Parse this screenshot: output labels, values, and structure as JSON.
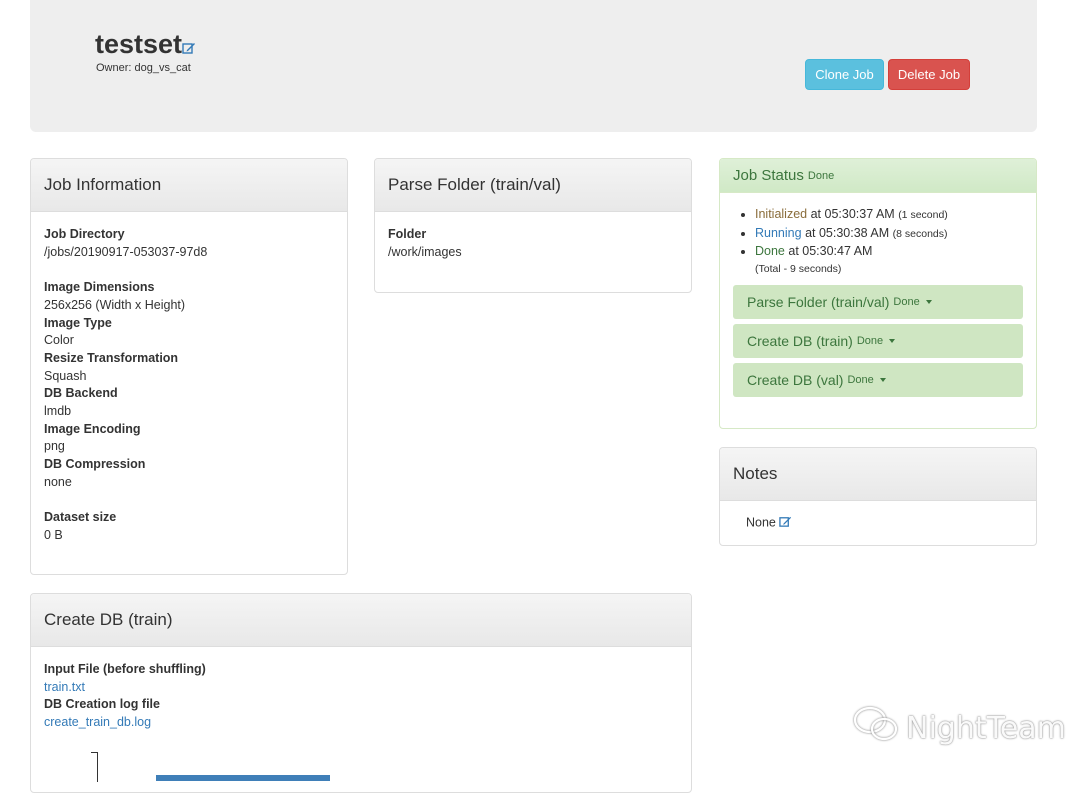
{
  "header": {
    "job_name": "testset",
    "owner": "Owner: dog_vs_cat",
    "clone_label": "Clone Job",
    "delete_label": "Delete Job"
  },
  "job_info": {
    "title": "Job Information",
    "job_directory_label": "Job Directory",
    "job_directory": "/jobs/20190917-053037-97d8",
    "image_dimensions_label": "Image Dimensions",
    "image_dimensions": "256x256 (Width x Height)",
    "image_type_label": "Image Type",
    "image_type": "Color",
    "resize_label": "Resize Transformation",
    "resize": "Squash",
    "db_backend_label": "DB Backend",
    "db_backend": "lmdb",
    "image_encoding_label": "Image Encoding",
    "image_encoding": "png",
    "db_compression_label": "DB Compression",
    "db_compression": "none",
    "dataset_size_label": "Dataset size",
    "dataset_size": "0 B"
  },
  "parse_folder": {
    "title": "Parse Folder (train/val)",
    "folder_label": "Folder",
    "folder": "/work/images"
  },
  "job_status": {
    "title": "Job Status",
    "status": "Done",
    "events": [
      {
        "state": "Initialized",
        "at": "at 05:30:37 AM",
        "duration": "(1 second)"
      },
      {
        "state": "Running",
        "at": "at 05:30:38 AM",
        "duration": "(8 seconds)"
      },
      {
        "state": "Done",
        "at": "at 05:30:47 AM",
        "duration": ""
      }
    ],
    "total": "(Total - 9 seconds)",
    "tasks": [
      {
        "name": "Parse Folder (train/val)",
        "status": "Done"
      },
      {
        "name": "Create DB (train)",
        "status": "Done"
      },
      {
        "name": "Create DB (val)",
        "status": "Done"
      }
    ]
  },
  "notes": {
    "title": "Notes",
    "value": "None"
  },
  "create_db": {
    "title": "Create DB (train)",
    "input_file_label": "Input File (before shuffling)",
    "input_file": "train.txt",
    "log_label": "DB Creation log file",
    "log_file": "create_train_db.log"
  },
  "watermark": {
    "text": "NightTeam"
  },
  "colors": {
    "clone_button": "#5bc0de",
    "delete_button": "#d9534f",
    "status_success": "#dff0d8",
    "link": "#337ab7"
  }
}
